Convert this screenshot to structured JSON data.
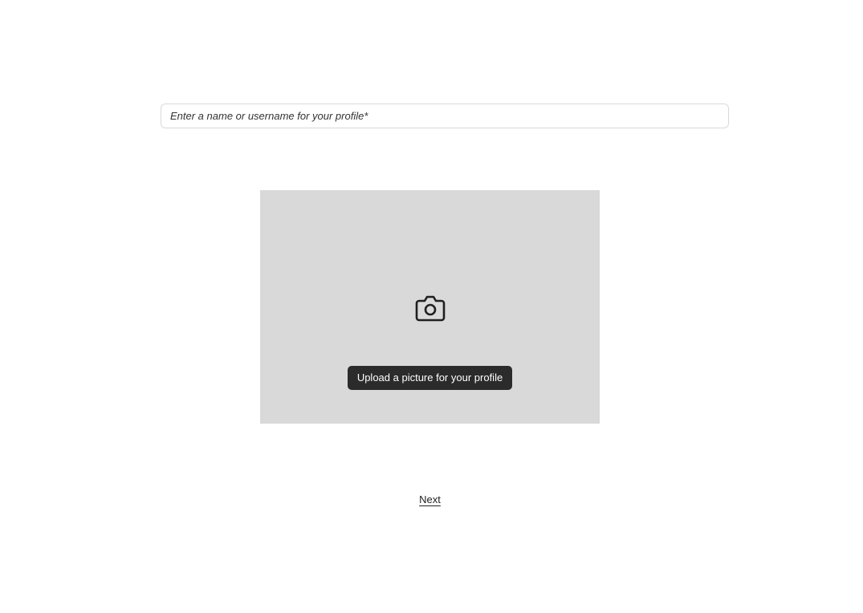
{
  "profile_form": {
    "name_field": {
      "value": "",
      "placeholder": "Enter a name or username for your profile*"
    },
    "upload": {
      "icon": "camera-icon",
      "button_label": "Upload a picture for your profile",
      "area_color": "#d9d9d9",
      "button_color": "#2b2b2b"
    },
    "next_label": "Next"
  }
}
